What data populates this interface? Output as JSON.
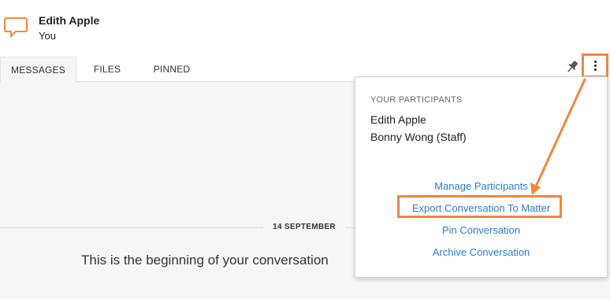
{
  "header": {
    "title": "Edith Apple",
    "subtitle": "You"
  },
  "tabs": [
    {
      "label": "MESSAGES",
      "active": true
    },
    {
      "label": "FILES",
      "active": false
    },
    {
      "label": "PINNED",
      "active": false
    }
  ],
  "toolbar": {
    "pin_icon": "pin-icon",
    "more_icon": "vertical-ellipsis-icon"
  },
  "conversation": {
    "date_separator": "14 SEPTEMBER",
    "beginning_text": "This is the beginning of your conversation"
  },
  "menu": {
    "heading": "YOUR PARTICIPANTS",
    "participants": [
      "Edith Apple",
      "Bonny Wong (Staff)"
    ],
    "actions": [
      "Manage Participants",
      "Export Conversation To Matter",
      "Pin Conversation",
      "Archive Conversation"
    ]
  },
  "colors": {
    "accent_orange": "#f0883e",
    "link_blue": "#2f7bd3"
  }
}
